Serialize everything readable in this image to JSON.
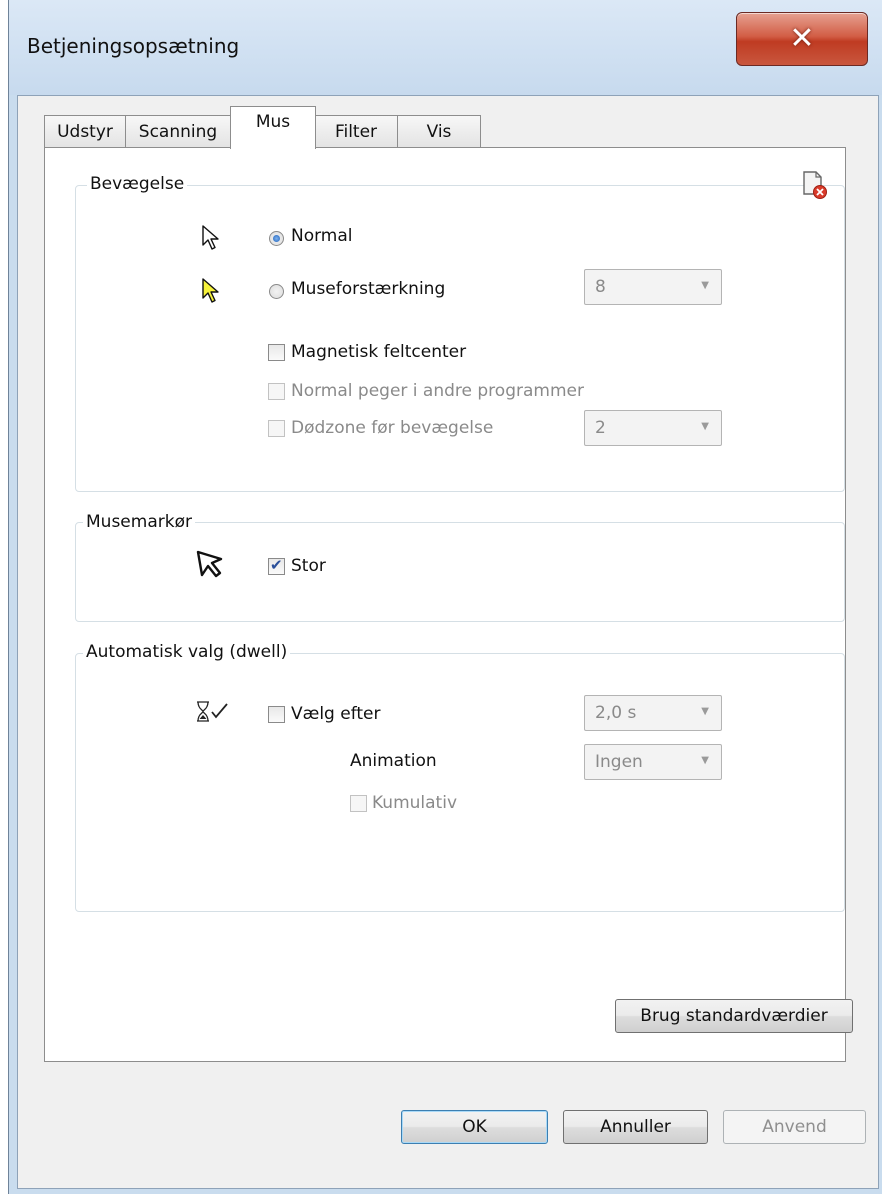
{
  "window": {
    "title": "Betjeningsopsætning"
  },
  "tabs": [
    {
      "label": "Udstyr"
    },
    {
      "label": "Scanning"
    },
    {
      "label": "Mus",
      "active": true
    },
    {
      "label": "Filter"
    },
    {
      "label": "Vis"
    }
  ],
  "movement": {
    "title": "Bevægelse",
    "reset_icon": "reset-document-icon",
    "normal_label": "Normal",
    "normal_selected": true,
    "gain_label": "Museforstærkning",
    "gain_selected": false,
    "gain_value": "8",
    "magnetic_label": "Magnetisk feltcenter",
    "magnetic_checked": false,
    "normal_pointer_label": "Normal peger i andre programmer",
    "deadzone_label": "Dødzone før bevægelse",
    "deadzone_value": "2"
  },
  "cursor": {
    "title": "Musemarkør",
    "large_label": "Stor",
    "large_checked": true
  },
  "dwell": {
    "title": "Automatisk valg (dwell)",
    "select_after_label": "Vælg efter",
    "select_after_checked": false,
    "select_after_value": "2,0 s",
    "animation_label": "Animation",
    "animation_value": "Ingen",
    "cumulative_label": "Kumulativ"
  },
  "buttons": {
    "defaults": "Brug standardværdier",
    "ok": "OK",
    "cancel": "Annuller",
    "apply": "Anvend"
  },
  "colors": {
    "close_button": "#c9432a",
    "selection": "#1c5fb8"
  }
}
